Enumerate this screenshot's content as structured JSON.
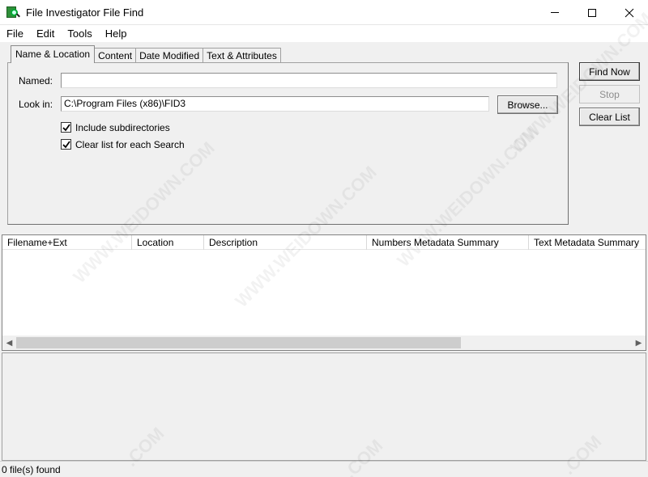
{
  "window": {
    "title": "File Investigator File Find"
  },
  "menu": [
    "File",
    "Edit",
    "Tools",
    "Help"
  ],
  "tabs": [
    "Name & Location",
    "Content",
    "Date Modified",
    "Text & Attributes"
  ],
  "form": {
    "named_label": "Named:",
    "named_value": "",
    "lookin_label": "Look in:",
    "lookin_value": "C:\\Program Files (x86)\\FID3",
    "browse_label": "Browse...",
    "include_subdirs_label": "Include subdirectories",
    "include_subdirs_checked": true,
    "clear_list_label": "Clear list for each Search",
    "clear_list_checked": true
  },
  "buttons": {
    "find_now": "Find Now",
    "stop": "Stop",
    "clear_list": "Clear List"
  },
  "list": {
    "columns": [
      "Filename+Ext",
      "Location",
      "Description",
      "Numbers Metadata Summary",
      "Text Metadata Summary"
    ]
  },
  "status": {
    "text": "0 file(s) found"
  },
  "watermark": "WWW.WEIDOWN.COM",
  "watermark_short": ".COM"
}
